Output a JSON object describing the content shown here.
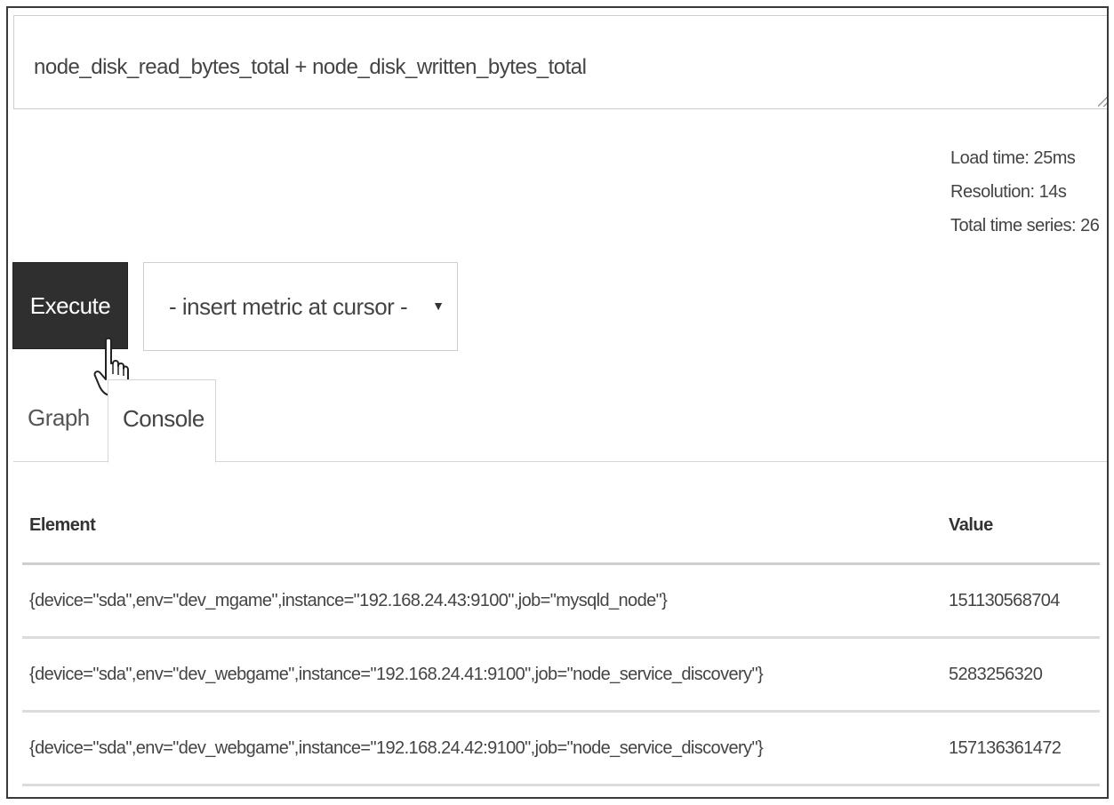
{
  "query": {
    "expression": "node_disk_read_bytes_total + node_disk_written_bytes_total"
  },
  "stats": {
    "load_time": "Load time: 25ms",
    "resolution": "Resolution: 14s",
    "total_series": "Total time series: 26"
  },
  "controls": {
    "execute_label": "Execute",
    "metric_select_label": "- insert metric at cursor -"
  },
  "tabs": [
    {
      "label": "Graph",
      "active": false
    },
    {
      "label": "Console",
      "active": true
    }
  ],
  "table": {
    "headers": {
      "element": "Element",
      "value": "Value"
    },
    "rows": [
      {
        "element": "{device=\"sda\",env=\"dev_mgame\",instance=\"192.168.24.43:9100\",job=\"mysqld_node\"}",
        "value": "151130568704"
      },
      {
        "element": "{device=\"sda\",env=\"dev_webgame\",instance=\"192.168.24.41:9100\",job=\"node_service_discovery\"}",
        "value": "5283256320"
      },
      {
        "element": "{device=\"sda\",env=\"dev_webgame\",instance=\"192.168.24.42:9100\",job=\"node_service_discovery\"}",
        "value": "157136361472"
      }
    ]
  },
  "icons": {
    "cursor": "hand-pointer-icon",
    "dropdown": "caret-down-icon",
    "resize": "resize-grip-icon"
  }
}
